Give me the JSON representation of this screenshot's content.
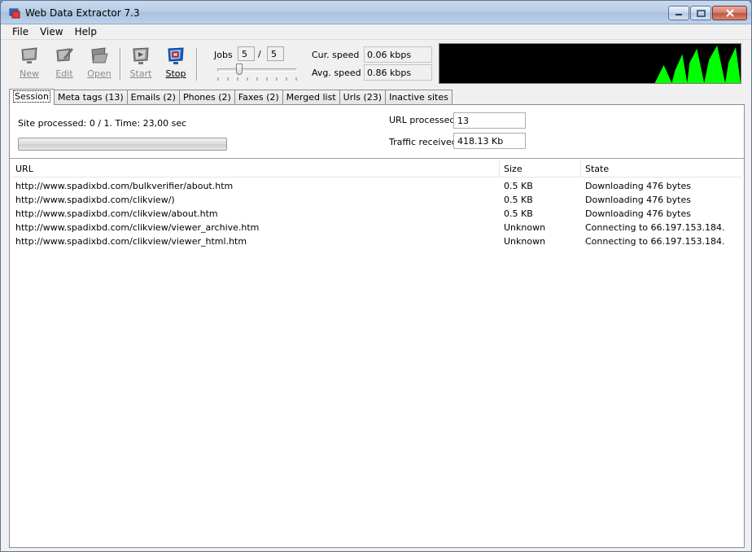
{
  "window": {
    "title": "Web Data Extractor 7.3"
  },
  "menu": [
    "File",
    "View",
    "Help"
  ],
  "toolbar": {
    "buttons": [
      {
        "label": "New",
        "icon": "new-monitor-icon",
        "enabled": false
      },
      {
        "label": "Edit",
        "icon": "edit-pencil-icon",
        "enabled": false
      },
      {
        "label": "Open",
        "icon": "open-folder-icon",
        "enabled": false
      },
      {
        "label": "Start",
        "icon": "start-play-icon",
        "enabled": false
      },
      {
        "label": "Stop",
        "icon": "stop-icon",
        "enabled": true
      }
    ],
    "jobs_label": "Jobs",
    "jobs_current": "5",
    "jobs_separator": "/",
    "jobs_max": "5",
    "cur_speed_label": "Cur. speed",
    "cur_speed_value": "0.06 kbps",
    "avg_speed_label": "Avg. speed",
    "avg_speed_value": "0.86 kbps",
    "graph_color": "#00ff00"
  },
  "tabs": [
    {
      "label": "Session",
      "active": true
    },
    {
      "label": "Meta tags (13)",
      "active": false
    },
    {
      "label": "Emails (2)",
      "active": false
    },
    {
      "label": "Phones (2)",
      "active": false
    },
    {
      "label": "Faxes (2)",
      "active": false
    },
    {
      "label": "Merged list",
      "active": false
    },
    {
      "label": "Urls (23)",
      "active": false
    },
    {
      "label": "Inactive sites",
      "active": false
    }
  ],
  "session": {
    "site_processed": "Site processed: 0 / 1. Time: 23,00 sec",
    "url_processed_label": "URL processed",
    "url_processed_value": "13",
    "traffic_received_label": "Traffic received",
    "traffic_received_value": "418.13 Kb"
  },
  "table": {
    "columns": [
      "URL",
      "Size",
      "State"
    ],
    "rows": [
      [
        "http://www.spadixbd.com/bulkverifier/about.htm",
        "0.5 KB",
        "Downloading 476 bytes"
      ],
      [
        "http://www.spadixbd.com/clikview/)",
        "0.5 KB",
        "Downloading 476 bytes"
      ],
      [
        "http://www.spadixbd.com/clikview/about.htm",
        "0.5 KB",
        "Downloading 476 bytes"
      ],
      [
        "http://www.spadixbd.com/clikview/viewer_archive.htm",
        "Unknown",
        "Connecting to 66.197.153.184."
      ],
      [
        "http://www.spadixbd.com/clikview/viewer_html.htm",
        "Unknown",
        "Connecting to 66.197.153.184."
      ]
    ]
  }
}
